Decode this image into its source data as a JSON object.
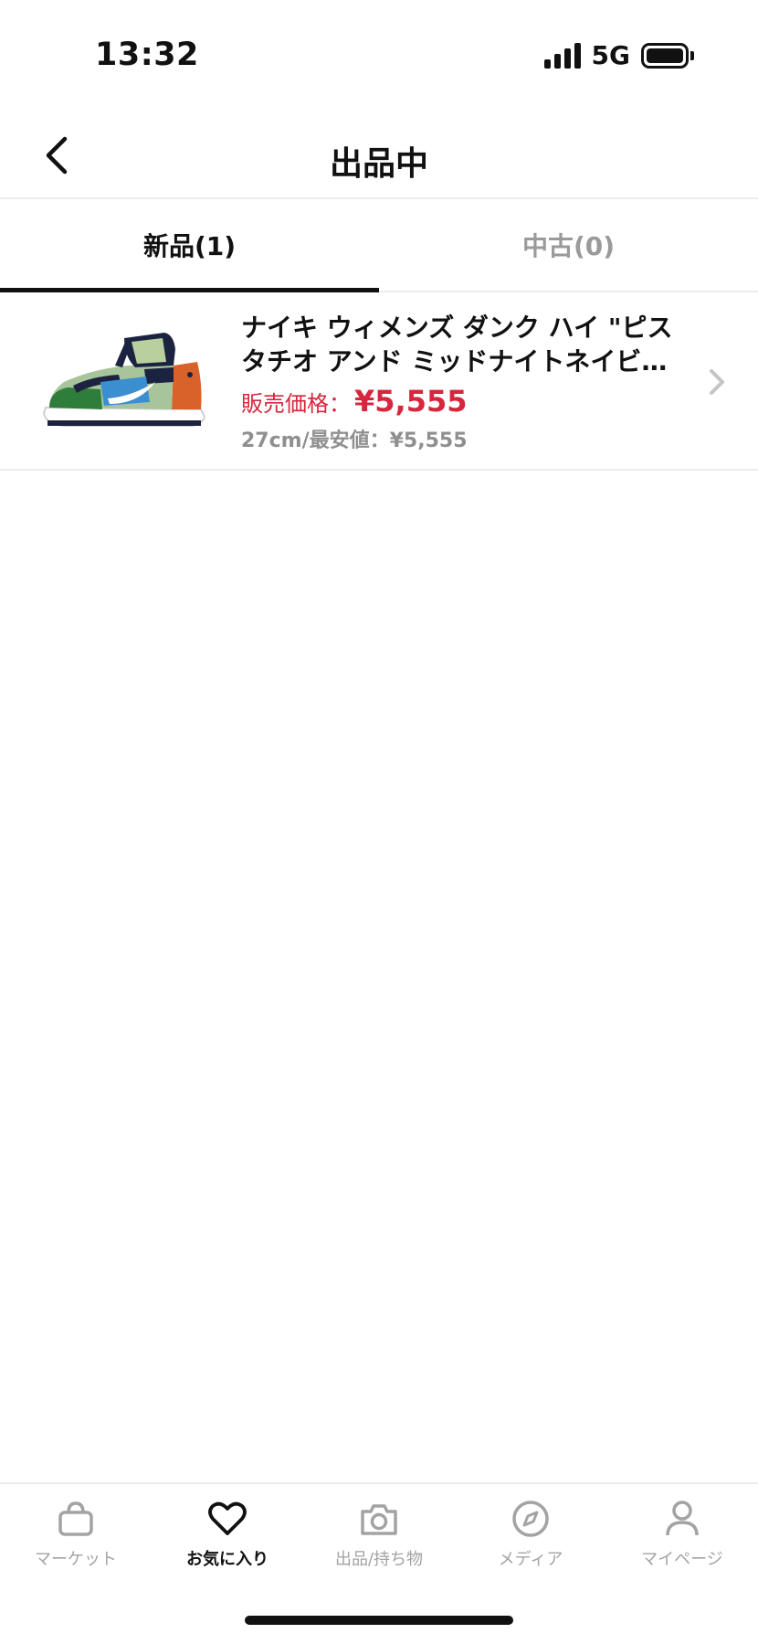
{
  "status_bar": {
    "time": "13:32",
    "network": "5G",
    "signal_icon": "cellular-signal-icon",
    "battery_icon": "battery-icon"
  },
  "header": {
    "title": "出品中",
    "back_icon": "back-chevron-icon"
  },
  "tabs": [
    {
      "label": "新品(1)",
      "active": true
    },
    {
      "label": "中古(0)",
      "active": false
    }
  ],
  "listing": {
    "title": "ナイキ ウィメンズ ダンク ハイ \"ピスタチオ アンド ミッドナイトネイビ…",
    "price_label": "販売価格：",
    "price": "¥5,555",
    "meta": "27cm/最安値：¥5,555",
    "image_icon": "sneaker-image",
    "chevron_icon": "chevron-right-icon"
  },
  "bottom_nav": [
    {
      "label": "マーケット",
      "icon": "shopping-bag-icon",
      "active": false
    },
    {
      "label": "お気に入り",
      "icon": "heart-icon",
      "active": true
    },
    {
      "label": "出品/持ち物",
      "icon": "camera-icon",
      "active": false
    },
    {
      "label": "メディア",
      "icon": "compass-icon",
      "active": false
    },
    {
      "label": "マイページ",
      "icon": "person-icon",
      "active": false
    }
  ],
  "colors": {
    "accent_price": "#d7263d",
    "inactive": "#a3a3a3",
    "active": "#111111",
    "divider": "#ececec"
  }
}
